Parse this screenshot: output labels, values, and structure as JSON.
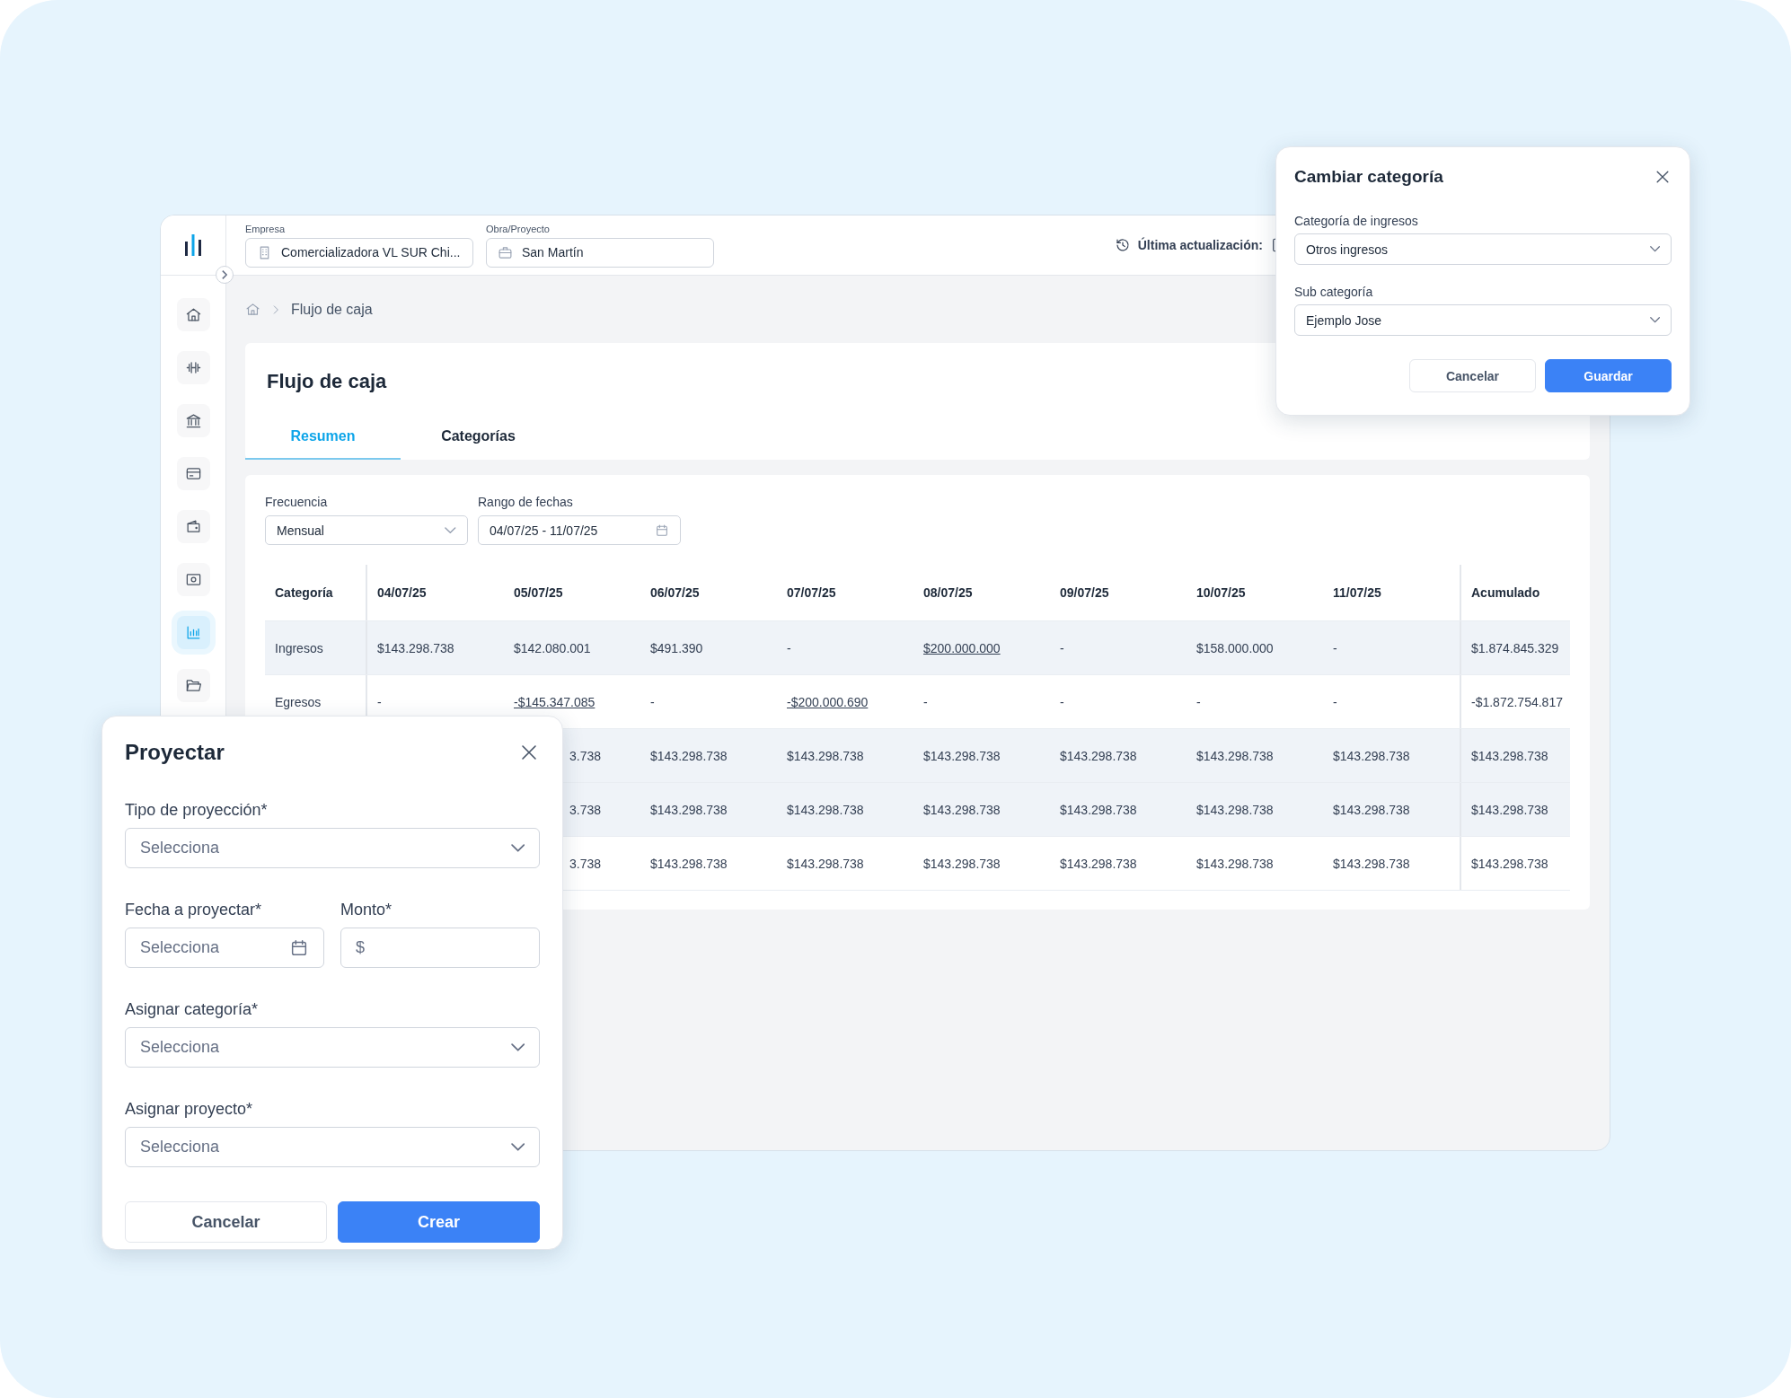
{
  "app": {
    "sidebar": {
      "items": [
        {
          "kind": "home",
          "selected": false
        },
        {
          "kind": "dumbbell",
          "selected": false
        },
        {
          "kind": "bank",
          "selected": false
        },
        {
          "kind": "card",
          "selected": false
        },
        {
          "kind": "wallet",
          "selected": false
        },
        {
          "kind": "money",
          "selected": false
        },
        {
          "kind": "chart",
          "selected": true
        },
        {
          "kind": "folder",
          "selected": false
        }
      ]
    },
    "header": {
      "selectors": [
        {
          "label": "Empresa",
          "value": "Comercializadora VL SUR Chi...",
          "kind": "building"
        },
        {
          "label": "Obra/Proyecto",
          "value": "San Martín",
          "kind": "briefcase"
        }
      ],
      "last_update": "Última actualización:"
    },
    "breadcrumb": [
      "Flujo de caja"
    ],
    "page_title": "Flujo de caja",
    "tabs": [
      {
        "label": "Resumen",
        "selected": true
      },
      {
        "label": "Categorías",
        "selected": false
      }
    ],
    "filters": [
      {
        "label": "Frecuencia",
        "value": "Mensual",
        "kind": "select"
      },
      {
        "label": "Rango de fechas",
        "value": "04/07/25 - 11/07/25",
        "kind": "date"
      }
    ],
    "table": {
      "columns": [
        "Categoría",
        "04/07/25",
        "05/07/25",
        "06/07/25",
        "07/07/25",
        "08/07/25",
        "09/07/25",
        "10/07/25",
        "11/07/25",
        "Acumulado"
      ],
      "rows": [
        {
          "shaded": true,
          "cells": [
            {
              "text": "Ingresos"
            },
            {
              "text": "$143.298.738"
            },
            {
              "text": "$142.080.001"
            },
            {
              "text": "$491.390"
            },
            {
              "text": "-"
            },
            {
              "text": "$200.000.000",
              "link": true
            },
            {
              "text": "-"
            },
            {
              "text": "$158.000.000"
            },
            {
              "text": "-"
            },
            {
              "text": "$1.874.845.329"
            }
          ]
        },
        {
          "shaded": false,
          "cells": [
            {
              "text": "Egresos"
            },
            {
              "text": "-"
            },
            {
              "text": "-$145.347.085",
              "link": true
            },
            {
              "text": "-"
            },
            {
              "text": "-$200.000.690",
              "link": true
            },
            {
              "text": "-"
            },
            {
              "text": "-"
            },
            {
              "text": "-"
            },
            {
              "text": "-"
            },
            {
              "text": "-$1.872.754.817"
            }
          ]
        },
        {
          "shaded": true,
          "cells": [
            {
              "text": "3.738",
              "clipped": true
            },
            {
              "text": "$143.298.738"
            },
            {
              "text": "$143.298.738"
            },
            {
              "text": "$143.298.738"
            },
            {
              "text": "$143.298.738"
            },
            {
              "text": "$143.298.738"
            },
            {
              "text": "$143.298.738"
            },
            {
              "text": "$143.298.738"
            }
          ]
        },
        {
          "shaded": true,
          "cells": [
            {
              "text": "3.738",
              "clipped": true
            },
            {
              "text": "$143.298.738"
            },
            {
              "text": "$143.298.738"
            },
            {
              "text": "$143.298.738"
            },
            {
              "text": "$143.298.738"
            },
            {
              "text": "$143.298.738"
            },
            {
              "text": "$143.298.738"
            },
            {
              "text": "$143.298.738"
            }
          ]
        },
        {
          "shaded": false,
          "cells": [
            {
              "text": "3.738",
              "clipped": true
            },
            {
              "text": "$143.298.738"
            },
            {
              "text": "$143.298.738"
            },
            {
              "text": "$143.298.738"
            },
            {
              "text": "$143.298.738"
            },
            {
              "text": "$143.298.738"
            },
            {
              "text": "$143.298.738"
            },
            {
              "text": "$143.298.738"
            }
          ]
        }
      ]
    }
  },
  "change_category_dialog": {
    "title": "Cambiar categoría",
    "fields": [
      {
        "label": "Categoría de ingresos",
        "value": "Otros ingresos"
      },
      {
        "label": "Sub categoría",
        "value": "Ejemplo Jose"
      }
    ],
    "buttons": [
      {
        "label": "Cancelar",
        "kind": "secondary"
      },
      {
        "label": "Guardar",
        "kind": "primary"
      }
    ]
  },
  "projection_dialog": {
    "title": "Proyectar",
    "fields": [
      {
        "label": "Tipo de proyección*",
        "placeholder": "Selecciona",
        "kind": "select"
      },
      {
        "label": "Fecha a proyectar*",
        "placeholder": "Selecciona",
        "kind": "date"
      },
      {
        "label": "Monto*",
        "placeholder": "$",
        "kind": "amount"
      },
      {
        "label": "Asignar categoría*",
        "placeholder": "Selecciona",
        "kind": "select"
      },
      {
        "label": "Asignar proyecto*",
        "placeholder": "Selecciona",
        "kind": "select"
      }
    ],
    "buttons": [
      {
        "label": "Cancelar",
        "kind": "secondary"
      },
      {
        "label": "Crear",
        "kind": "primary"
      }
    ]
  }
}
